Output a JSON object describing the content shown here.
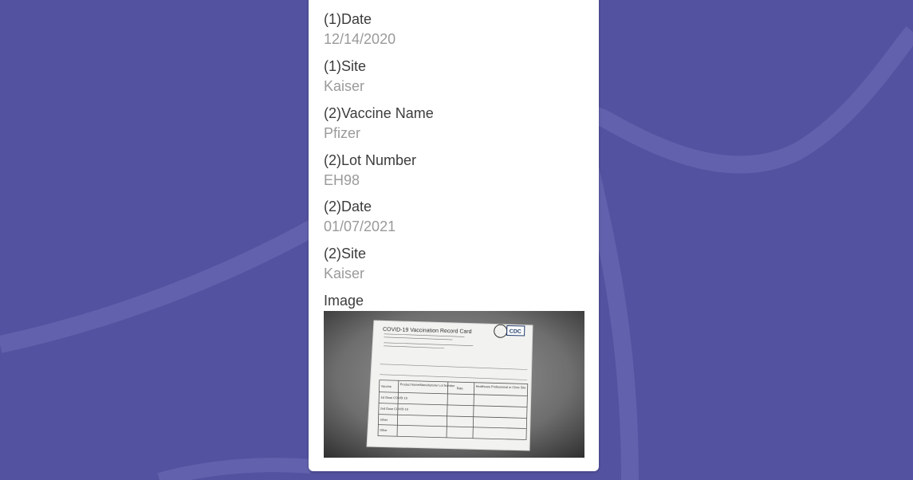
{
  "colors": {
    "background": "#5352a0",
    "card": "#ffffff",
    "label": "#3c3c3c",
    "value": "#9a9a9a"
  },
  "record": {
    "fields": [
      {
        "label": "(1)Date",
        "value": "12/14/2020"
      },
      {
        "label": "(1)Site",
        "value": "Kaiser"
      },
      {
        "label": "(2)Vaccine Name",
        "value": "Pfizer"
      },
      {
        "label": "(2)Lot Number",
        "value": "EH98"
      },
      {
        "label": "(2)Date",
        "value": "01/07/2021"
      },
      {
        "label": "(2)Site",
        "value": "Kaiser"
      }
    ],
    "image_label": "Image",
    "image": {
      "card_title": "COVID-19 Vaccination Record Card",
      "logo_text": "CDC",
      "columns": [
        "Vaccine",
        "Product Name/Manufacturer Lot Number",
        "Date",
        "Healthcare Professional or Clinic Site"
      ],
      "rows": [
        "1st Dose COVID-19",
        "2nd Dose COVID-19",
        "Other",
        "Other"
      ]
    }
  }
}
